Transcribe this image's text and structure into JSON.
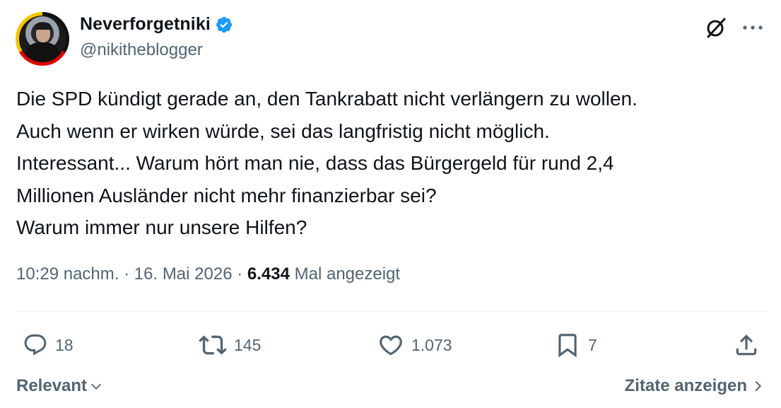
{
  "author": {
    "display_name": "Neverforgetniki",
    "handle": "@nikitheblogger",
    "verified": true,
    "verified_color": "#1d9bf0"
  },
  "tweet": {
    "text": "Die SPD kündigt gerade an, den Tankrabatt nicht verlängern zu wollen.\nAuch wenn er wirken würde, sei das langfristig nicht möglich.\nInteressant... Warum hört man nie, dass das Bürgergeld für rund 2,4\nMillionen Ausländer nicht mehr finanzierbar sei?\nWarum immer nur unsere Hilfen?",
    "time": "10:29 nachm.",
    "separator": "·",
    "date": "16. Mai 2026",
    "views_count": "6.434",
    "views_label": "Mal angezeigt"
  },
  "actions": {
    "replies": "18",
    "reposts": "145",
    "likes": "1.073",
    "bookmarks": "7"
  },
  "footer": {
    "sort_label": "Relevant",
    "quotes_label": "Zitate anzeigen"
  },
  "icons": {
    "top_right": [
      "grok-icon",
      "more-icon"
    ],
    "actions": [
      "reply-icon",
      "repost-icon",
      "like-icon",
      "bookmark-icon",
      "share-icon"
    ]
  },
  "colors": {
    "text_primary": "#0f1419",
    "text_secondary": "#536471",
    "divider": "#eff3f4"
  }
}
